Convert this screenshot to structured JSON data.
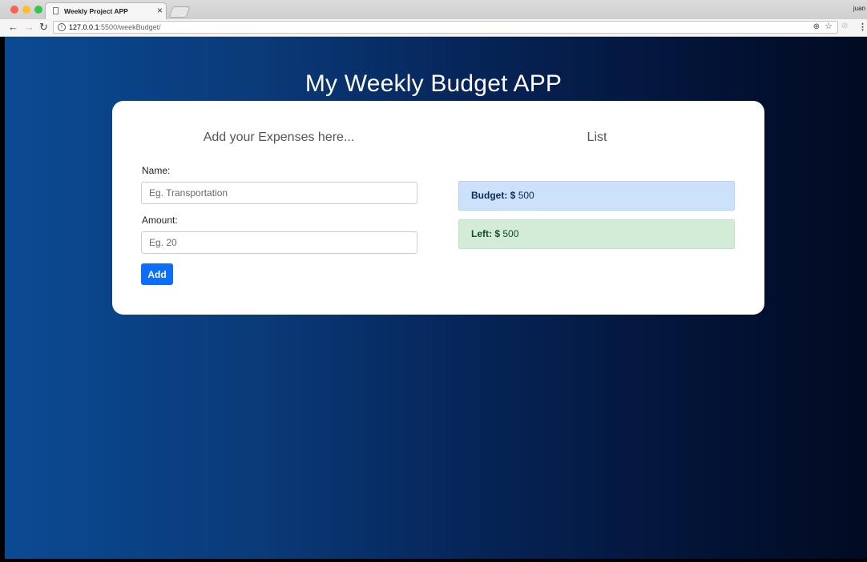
{
  "browser": {
    "tab_title": "Weekly Project APP",
    "tab_close": "×",
    "user_name": "juan",
    "url_host": "127.0.0.1",
    "url_path": ":5500/weekBudget/",
    "icons": {
      "back": "←",
      "forward": "→",
      "reload": "↻",
      "info": "i",
      "zoom": "⊕",
      "star": "☆",
      "extension": "⊘",
      "menu": "⋮"
    }
  },
  "app": {
    "title": "My Weekly Budget APP",
    "form": {
      "heading": "Add your Expenses here...",
      "name_label": "Name:",
      "name_placeholder": "Eg. Transportation",
      "name_value": "",
      "amount_label": "Amount:",
      "amount_placeholder": "Eg. 20",
      "amount_value": "",
      "add_label": "Add"
    },
    "list": {
      "heading": "List",
      "budget_label": "Budget: $",
      "budget_value": "500",
      "left_label": "Left: $",
      "left_value": "500"
    }
  },
  "colors": {
    "primary_button": "#0d6efd",
    "budget_bg": "#cce1fa",
    "left_bg": "#d2ecd8",
    "background_start": "#0b4a93",
    "background_end": "#010b22"
  }
}
